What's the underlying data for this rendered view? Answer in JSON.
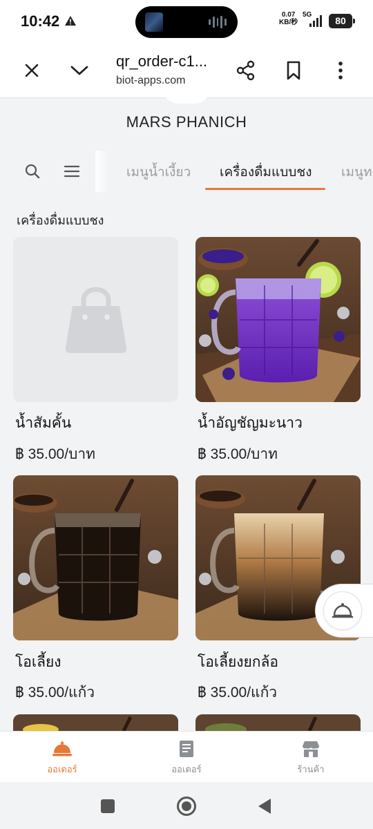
{
  "status_bar": {
    "time": "10:42",
    "net_speed_value": "0.07",
    "net_speed_unit": "KB/秒",
    "network_type": "5G",
    "battery": "80"
  },
  "browser": {
    "url_title": "qr_order-c1...",
    "url_host": "biot-apps.com"
  },
  "shop": {
    "name": "MARS PHANICH"
  },
  "categories": [
    {
      "label": "เมนูน้ำเงี้ยว",
      "active": false
    },
    {
      "label": "เครื่องดื่มแบบชง",
      "active": true
    },
    {
      "label": "เมนูท",
      "active": false
    }
  ],
  "section_title": "เครื่องดื่มแบบชง",
  "products": [
    {
      "name": "น้ำสัมคั้น",
      "price": "฿ 35.00/บาท",
      "image": "placeholder-bag-icon"
    },
    {
      "name": "น้ำอัญชัญมะนาว",
      "price": "฿ 35.00/บาท",
      "image": "butterfly-pea-lime-drink"
    },
    {
      "name": "โอเลี้ยง",
      "price": "฿ 35.00/แก้ว",
      "image": "black-iced-coffee"
    },
    {
      "name": "โอเลี้ยงยกล้อ",
      "price": "฿ 35.00/แก้ว",
      "image": "iced-coffee-with-cream"
    }
  ],
  "bottom_nav": [
    {
      "label": "ออเดอร์",
      "icon": "service-bell-icon",
      "active": true
    },
    {
      "label": "ออเดอร์",
      "icon": "receipt-icon",
      "active": false
    },
    {
      "label": "ร้านค้า",
      "icon": "storefront-icon",
      "active": false
    }
  ],
  "colors": {
    "accent": "#e5793a",
    "background": "#f1f3f4"
  }
}
